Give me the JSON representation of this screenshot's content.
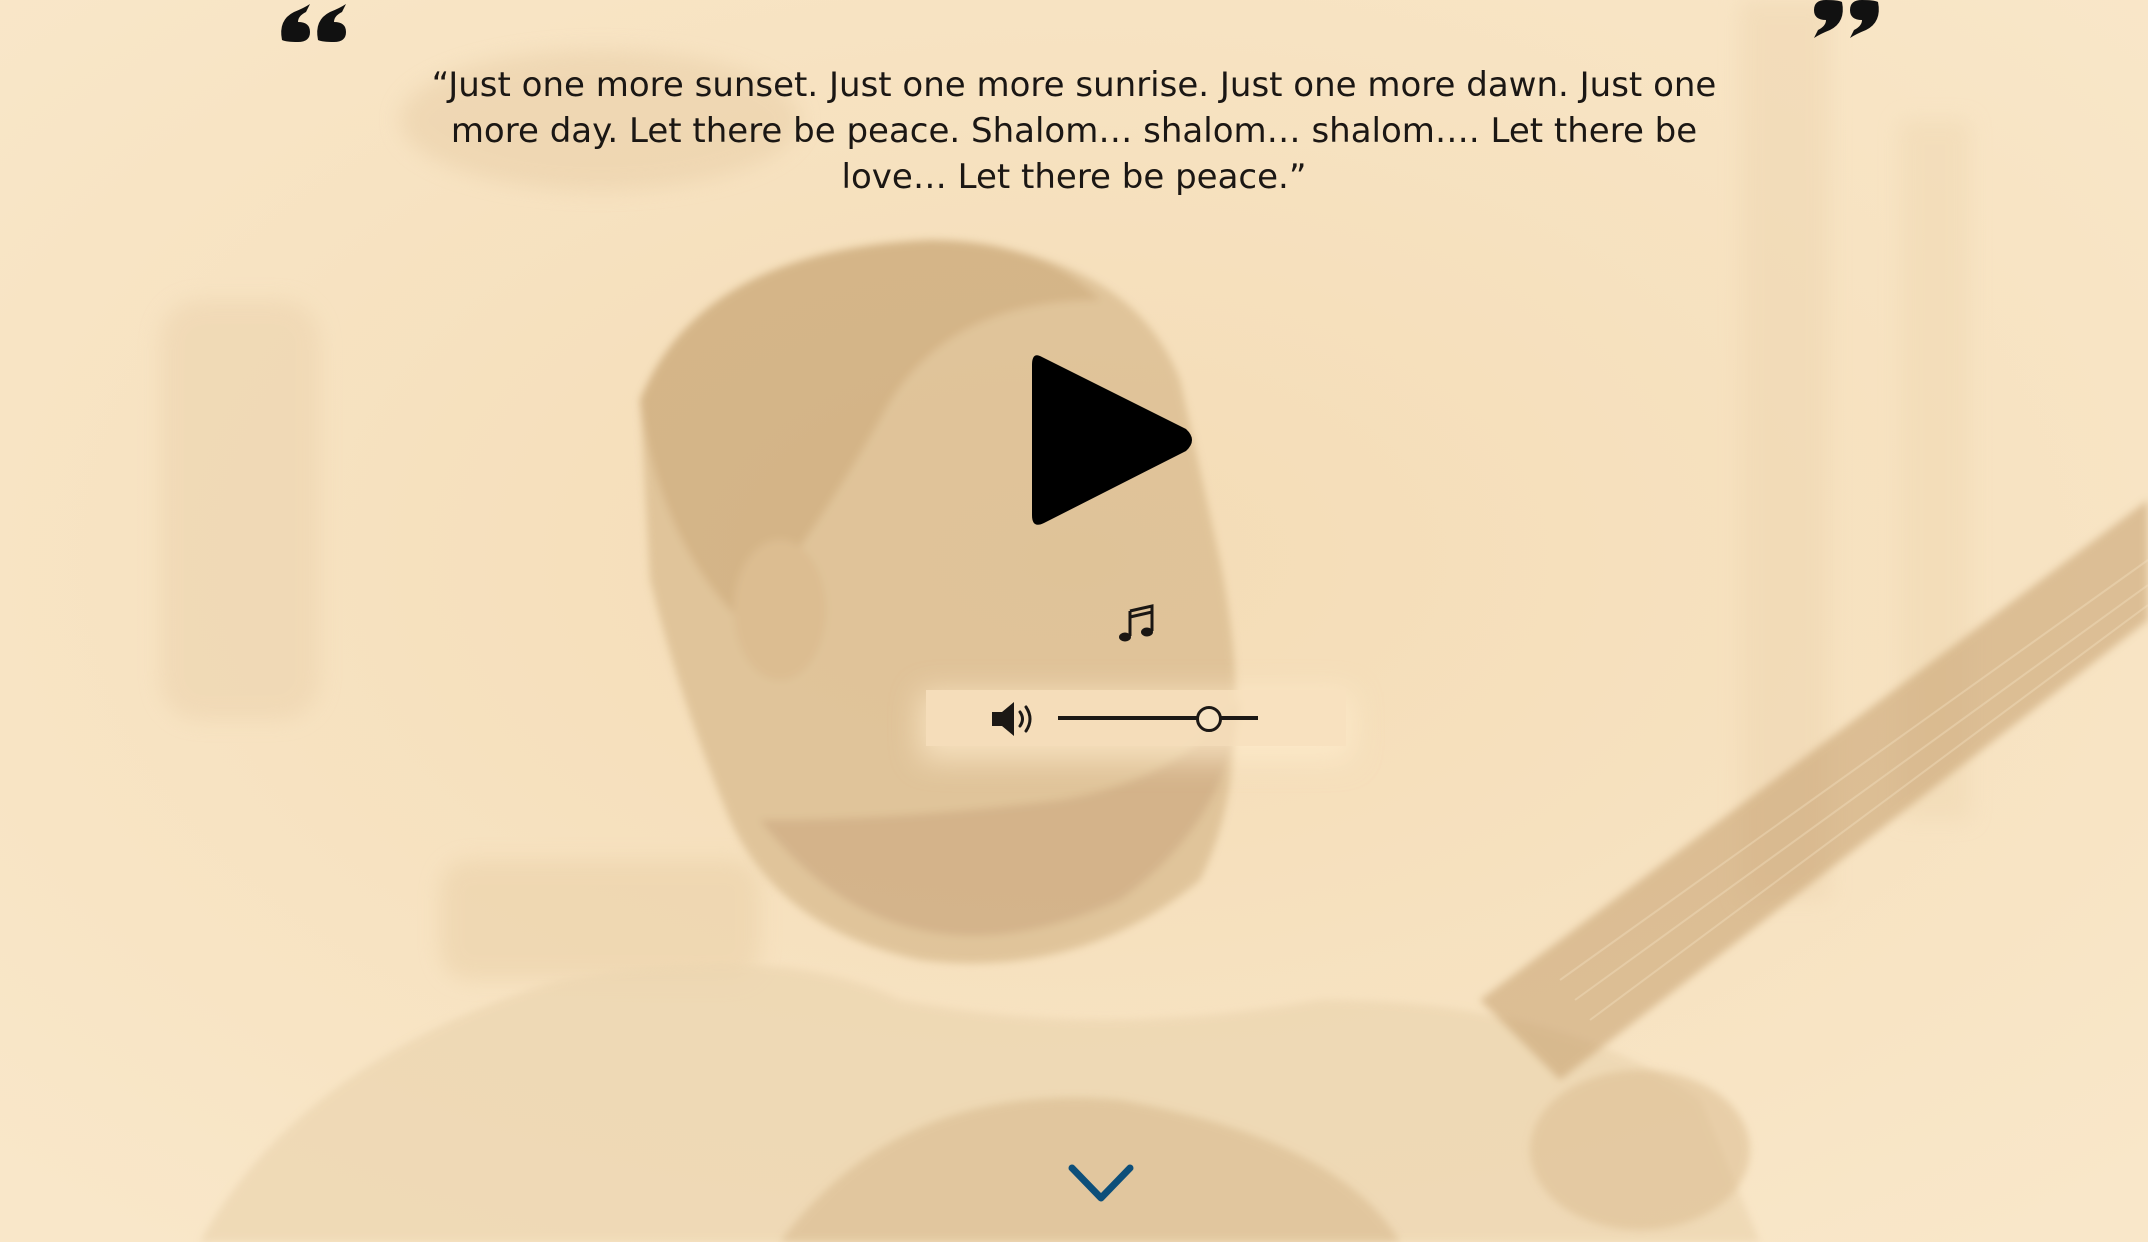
{
  "quote": {
    "text": "“Just one more sunset. Just one more sunrise. Just one more dawn. Just one more day. Let there be peace. Shalom… shalom… shalom…. Let there be love… Let there be peace.”"
  },
  "player": {
    "play_icon": "play-icon",
    "music_icon": "music-note-icon",
    "volume_icon": "speaker-volume-icon",
    "volume_level": 0.75
  },
  "navigation": {
    "scroll_icon": "chevron-down-icon"
  },
  "colors": {
    "background": "#f7e3c1",
    "text": "#1b1714",
    "icon": "#000000",
    "accent": "#0d4f7a"
  }
}
